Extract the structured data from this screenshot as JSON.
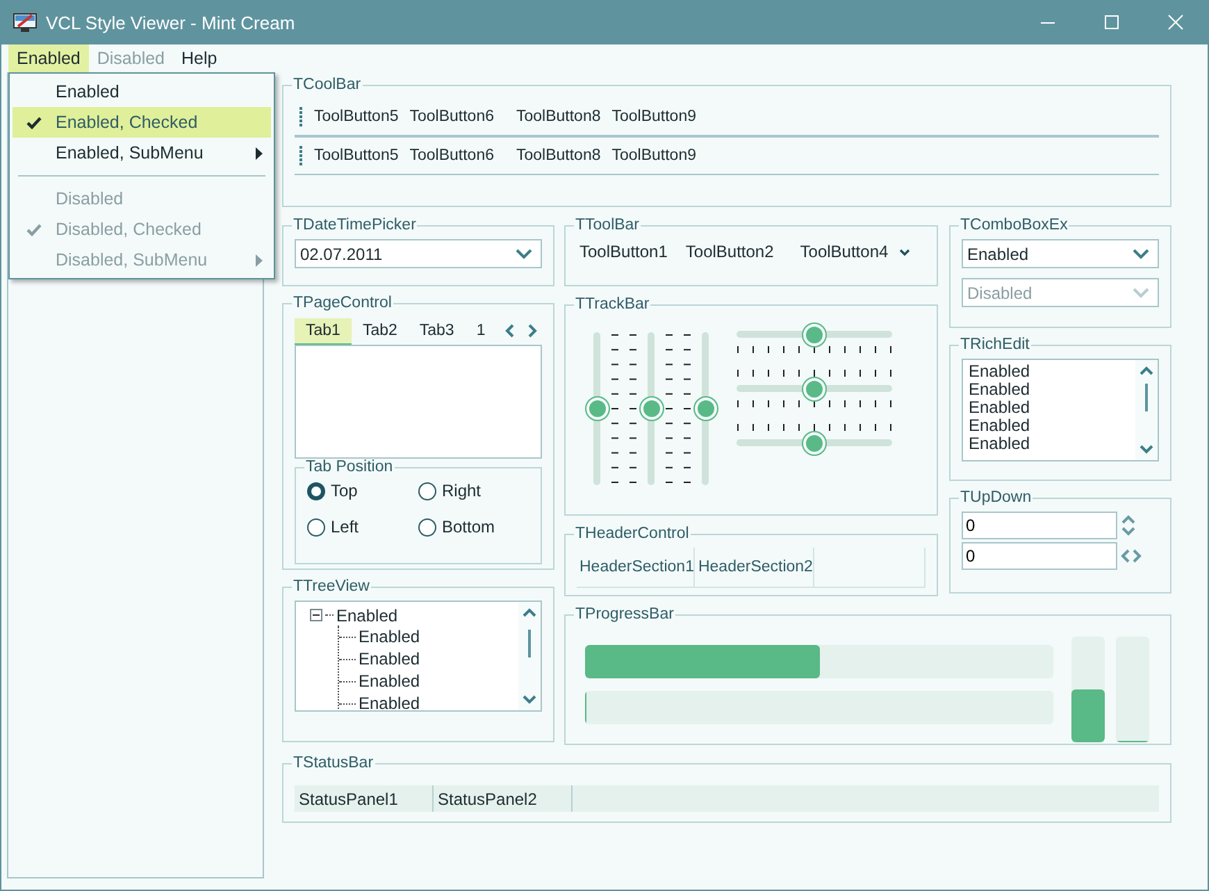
{
  "window": {
    "title": "VCL Style Viewer - Mint Cream"
  },
  "menu_bar": [
    {
      "label": "Enabled",
      "selected": true,
      "disabled": false
    },
    {
      "label": "Disabled",
      "selected": false,
      "disabled": true
    },
    {
      "label": "Help",
      "selected": false,
      "disabled": false
    }
  ],
  "dropdown_menu": [
    {
      "kind": "item",
      "label": "Enabled",
      "checked": false,
      "disabled": false,
      "submenu": false,
      "selected": false
    },
    {
      "kind": "item",
      "label": "Enabled, Checked",
      "checked": true,
      "disabled": false,
      "submenu": false,
      "selected": true
    },
    {
      "kind": "item",
      "label": "Enabled, SubMenu",
      "checked": false,
      "disabled": false,
      "submenu": true,
      "selected": false
    },
    {
      "kind": "separator"
    },
    {
      "kind": "item",
      "label": "Disabled",
      "checked": false,
      "disabled": true,
      "submenu": false,
      "selected": false
    },
    {
      "kind": "item",
      "label": "Disabled, Checked",
      "checked": true,
      "disabled": true,
      "submenu": false,
      "selected": false
    },
    {
      "kind": "item",
      "label": "Disabled, SubMenu",
      "checked": false,
      "disabled": true,
      "submenu": true,
      "selected": false
    }
  ],
  "coolbar": {
    "title": "TCoolBar",
    "bands": [
      {
        "buttons": [
          "ToolButton5",
          "ToolButton6",
          "ToolButton8",
          "ToolButton9"
        ]
      },
      {
        "buttons": [
          "ToolButton5",
          "ToolButton6",
          "ToolButton8",
          "ToolButton9"
        ]
      }
    ]
  },
  "datetimepicker": {
    "title": "TDateTimePicker",
    "value": "02.07.2011"
  },
  "pagecontrol": {
    "title": "TPageControl",
    "tabs": [
      {
        "label": "Tab1",
        "selected": true
      },
      {
        "label": "Tab2",
        "selected": false
      },
      {
        "label": "Tab3",
        "selected": false
      },
      {
        "label": "1",
        "selected": false
      }
    ],
    "tab_position": {
      "title": "Tab Position",
      "options": [
        {
          "label": "Top",
          "selected": true
        },
        {
          "label": "Right",
          "selected": false
        },
        {
          "label": "Left",
          "selected": false
        },
        {
          "label": "Bottom",
          "selected": false
        }
      ]
    }
  },
  "treeview": {
    "title": "TTreeView",
    "nodes": [
      {
        "label": "Enabled",
        "expanded": true,
        "children": [
          {
            "label": "Enabled"
          },
          {
            "label": "Enabled"
          },
          {
            "label": "Enabled"
          },
          {
            "label": "Enabled"
          }
        ]
      }
    ]
  },
  "toolbar": {
    "title": "TToolBar",
    "buttons": [
      {
        "kind": "plain",
        "label": "ToolButton1"
      },
      {
        "kind": "plain",
        "label": "ToolButton2"
      },
      {
        "kind": "dropdown",
        "label": "ToolButton4"
      }
    ]
  },
  "trackbar": {
    "title": "TTrackBar",
    "vertical": [
      {
        "level": 0.5,
        "kind": "after"
      },
      {
        "level": 0.5,
        "kind": "both"
      },
      {
        "level": 0.5,
        "kind": "before"
      }
    ],
    "horizontal": [
      {
        "level": 0.5,
        "kind": "after"
      },
      {
        "level": 0.5,
        "kind": "both"
      },
      {
        "level": 0.5,
        "kind": "before"
      }
    ]
  },
  "headercontrol": {
    "title": "THeaderControl",
    "sections": [
      "HeaderSection1",
      "HeaderSection2"
    ]
  },
  "comboboxex": {
    "title": "TComboBoxEx",
    "combos": [
      {
        "value": "Enabled",
        "disabled": false
      },
      {
        "value": "Disabled",
        "disabled": true
      }
    ]
  },
  "richedit": {
    "title": "TRichEdit",
    "lines": [
      "Enabled",
      "Enabled",
      "Enabled",
      "Enabled",
      "Enabled"
    ]
  },
  "updown": {
    "title": "TUpDown",
    "fields": [
      {
        "value": "0",
        "kind": "vertical"
      },
      {
        "value": "0",
        "kind": "horizontal"
      }
    ]
  },
  "progressbar": {
    "title": "TProgressBar",
    "horizontal": [
      {
        "level": 0.5
      },
      {
        "level": 0
      }
    ],
    "vertical": [
      {
        "level": 0.5
      },
      {
        "level": 0
      }
    ]
  },
  "statusbar": {
    "title": "TStatusBar",
    "panels": [
      "StatusPanel1",
      "StatusPanel2"
    ]
  }
}
